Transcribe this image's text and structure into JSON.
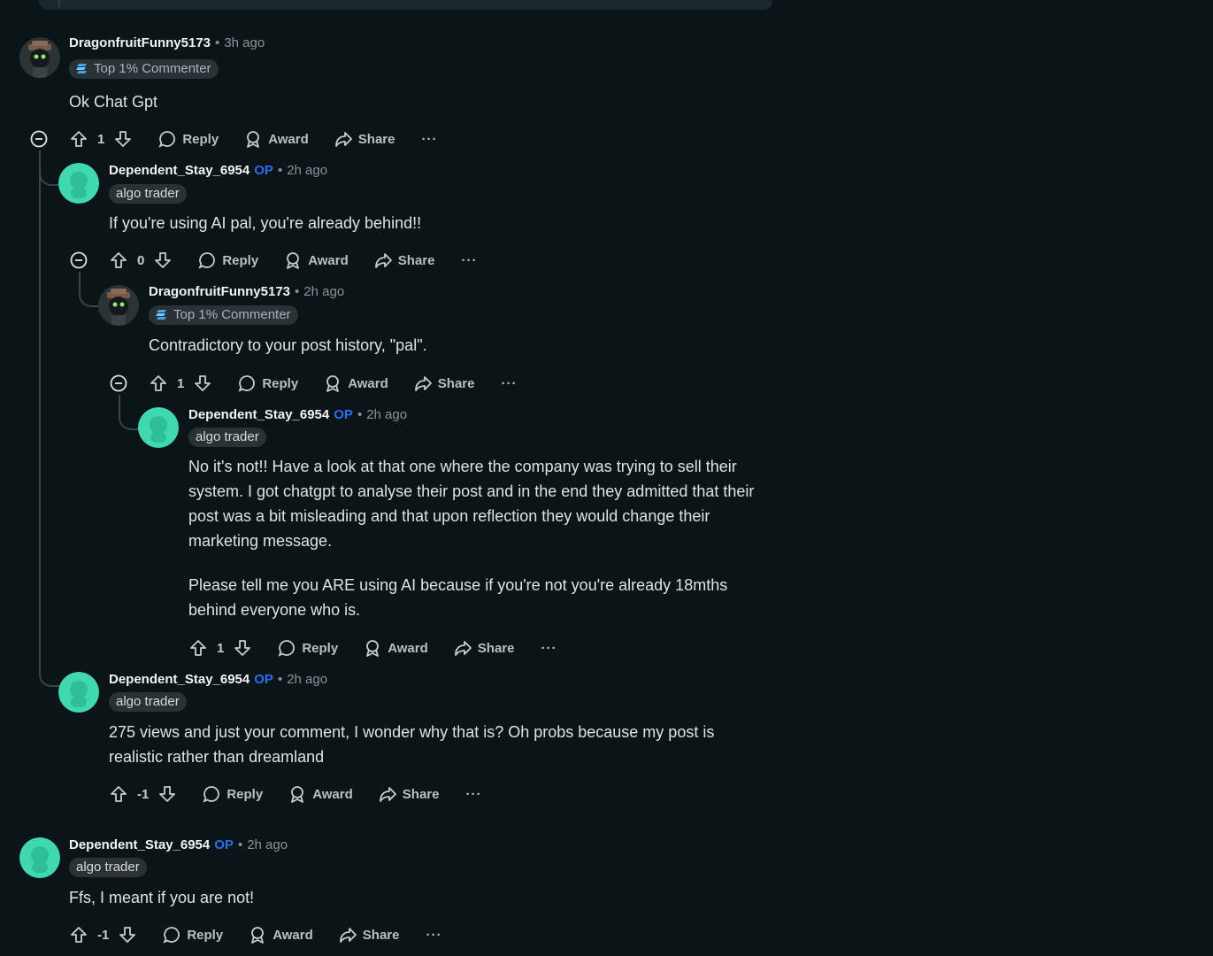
{
  "comments": [
    {
      "username": "DragonfruitFunny5173",
      "op_label": "",
      "time": "3h ago",
      "flair": "Top 1% Commenter",
      "body": [
        "Ok Chat Gpt"
      ],
      "votes": "1",
      "actions": {
        "reply": "Reply",
        "award": "Award",
        "share": "Share",
        "more": "···"
      }
    },
    {
      "username": "Dependent_Stay_6954",
      "op_label": "OP",
      "time": "2h ago",
      "flair": "algo trader",
      "body": [
        "If you're using AI pal, you're already behind!!"
      ],
      "votes": "0",
      "actions": {
        "reply": "Reply",
        "award": "Award",
        "share": "Share",
        "more": "···"
      }
    },
    {
      "username": "DragonfruitFunny5173",
      "op_label": "",
      "time": "2h ago",
      "flair": "Top 1% Commenter",
      "body": [
        "Contradictory to your post history, \"pal\"."
      ],
      "votes": "1",
      "actions": {
        "reply": "Reply",
        "award": "Award",
        "share": "Share",
        "more": "···"
      }
    },
    {
      "username": "Dependent_Stay_6954",
      "op_label": "OP",
      "time": "2h ago",
      "flair": "algo trader",
      "body": [
        "No it's not!! Have a look at that one where the company was trying to sell their system. I got chatgpt to analyse their post and in the end they admitted that their post was a bit misleading and that upon reflection they would change their marketing message.",
        "Please tell me you ARE using AI because if you're not you're already 18mths behind everyone who is."
      ],
      "votes": "1",
      "actions": {
        "reply": "Reply",
        "award": "Award",
        "share": "Share",
        "more": "···"
      }
    },
    {
      "username": "Dependent_Stay_6954",
      "op_label": "OP",
      "time": "2h ago",
      "flair": "algo trader",
      "body": [
        "275 views and just your comment, I wonder why that is? Oh probs because my post is realistic rather than dreamland"
      ],
      "votes": "-1",
      "actions": {
        "reply": "Reply",
        "award": "Award",
        "share": "Share",
        "more": "···"
      }
    },
    {
      "username": "Dependent_Stay_6954",
      "op_label": "OP",
      "time": "2h ago",
      "flair": "algo trader",
      "body": [
        "Ffs, I meant if you are not!"
      ],
      "votes": "-1",
      "actions": {
        "reply": "Reply",
        "award": "Award",
        "share": "Share",
        "more": "···"
      }
    }
  ],
  "colors": {
    "background": "#0b1416",
    "op": "#2a6df0",
    "avatar_teal": "#3fd8b0"
  },
  "icons": {
    "collapse": "minus-circle-icon",
    "upvote": "arrow-up-icon",
    "downvote": "arrow-down-icon",
    "reply": "speech-bubble-icon",
    "award": "award-ribbon-icon",
    "share": "share-arrow-icon"
  }
}
